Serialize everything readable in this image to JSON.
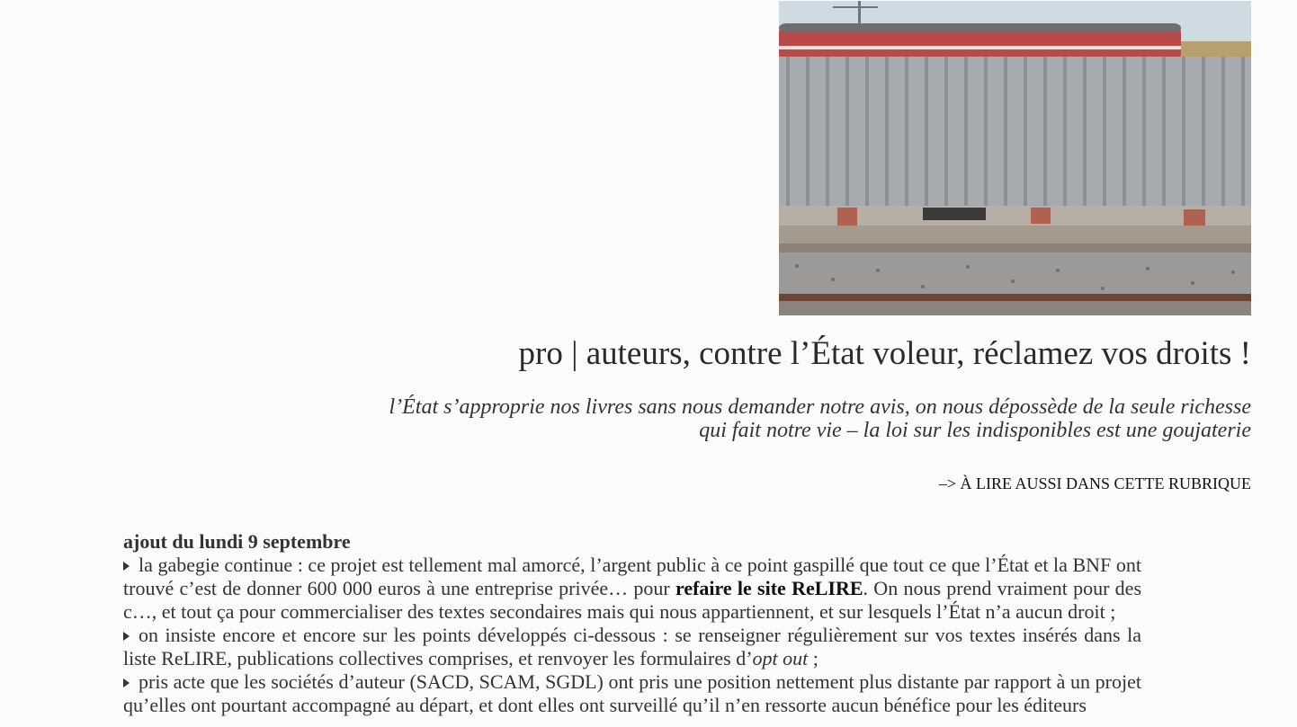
{
  "article": {
    "title": "pro | auteurs, contre l’État voleur, réclamez vos droits !",
    "subtitle": "l’État s’approprie nos livres sans nous demander notre avis, on nous dépossède de la seule richesse qui fait notre vie – la loi sur les indisponibles est une goujaterie",
    "see_also": "–> À LIRE AUSSI DANS CETTE RUBRIQUE",
    "heading": "ajout du lundi 9 septembre",
    "p1_a": "la gabegie continue : ce projet est tellement mal amorcé, l’argent public à ce point gaspillé que tout ce que l’État et la BNF ont trouvé c’est de donner 600 000 euros à une entreprise privée… pour ",
    "p1_link": "refaire le site ReLIRE",
    "p1_b": ". On nous prend vraiment pour des c…, et tout ça pour commercialiser des textes secondaires mais qui nous appartiennent, et sur lesquels l’État n’a aucun droit ;",
    "p2_a": "on insiste encore et encore sur les points développés ci-dessous : se renseigner régulièrement sur vos textes insérés dans la liste ReLIRE, publications collectives comprises, et renvoyer les formulaires d’",
    "p2_em": "opt out",
    "p2_b": " ;",
    "p3": "pris acte que les sociétés d’auteur (SACD, SCAM, SGDL) ont pris une position nettement plus distante par rapport à un projet qu’elles ont pourtant accompagné au départ, et dont elles ont surveillé qu’il n’en ressorte aucun bénéfice pour les éditeurs"
  },
  "icons": {
    "bullet": "triangle-right-icon"
  }
}
